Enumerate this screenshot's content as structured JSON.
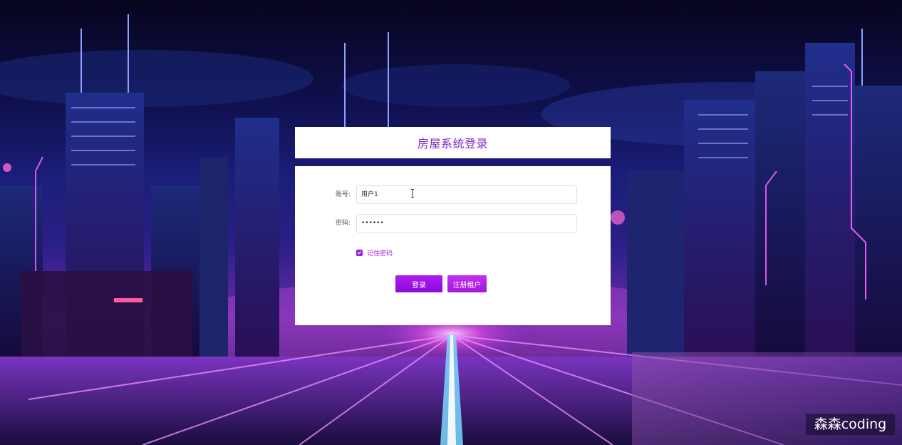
{
  "login": {
    "title": "房屋系统登录",
    "account_label": "账号:",
    "account_value": "用户1",
    "password_label": "密码:",
    "password_value": "••••••",
    "remember_label": "记住密码",
    "remember_checked": true,
    "login_button": "登录",
    "register_button": "注册租户"
  },
  "watermark": "森森coding",
  "colors": {
    "accent": "#a21cdb",
    "title": "#7a28c9",
    "button": "#9b12e0"
  }
}
